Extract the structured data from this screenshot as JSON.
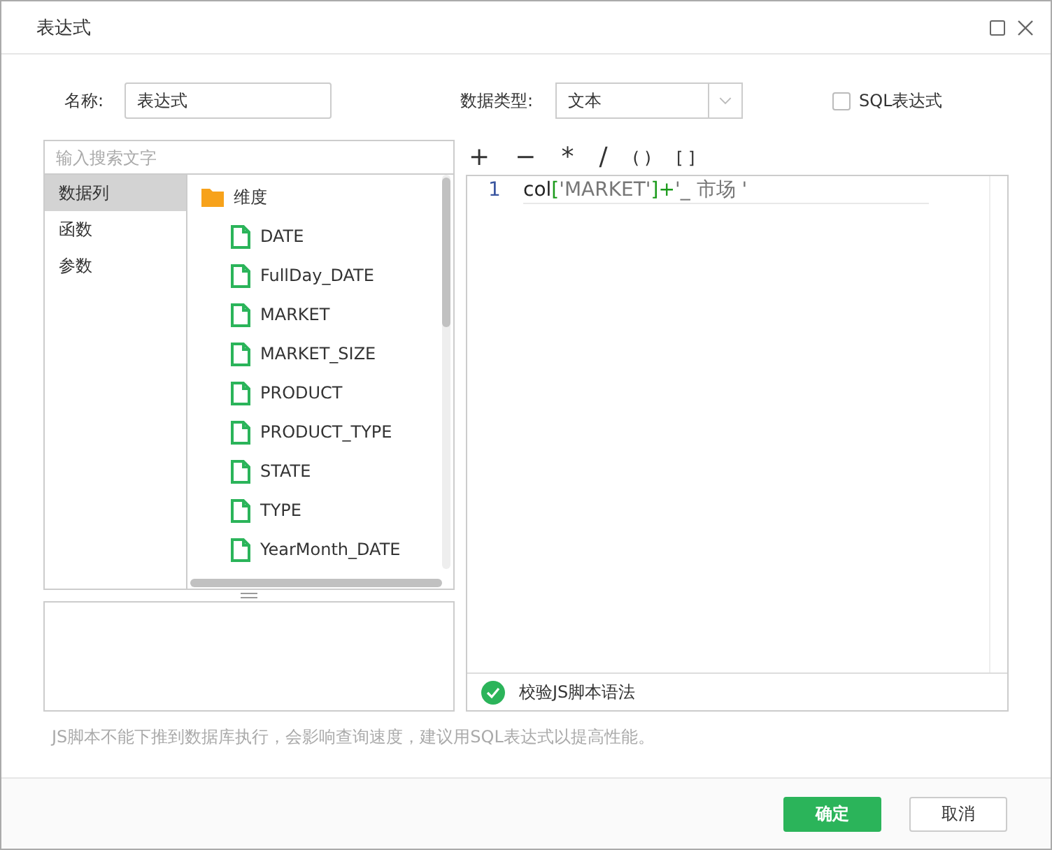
{
  "window": {
    "title": "表达式"
  },
  "name_field": {
    "label": "名称:",
    "value": "表达式"
  },
  "type_field": {
    "label": "数据类型:",
    "value": "文本"
  },
  "sql_option": {
    "label": "SQL表达式",
    "checked": false
  },
  "search": {
    "placeholder": "输入搜索文字"
  },
  "categories": [
    {
      "label": "数据列",
      "selected": true
    },
    {
      "label": "函数",
      "selected": false
    },
    {
      "label": "参数",
      "selected": false
    }
  ],
  "tree": {
    "label": "维度",
    "children": [
      {
        "label": "DATE"
      },
      {
        "label": "FullDay_DATE"
      },
      {
        "label": "MARKET"
      },
      {
        "label": "MARKET_SIZE"
      },
      {
        "label": "PRODUCT"
      },
      {
        "label": "PRODUCT_TYPE"
      },
      {
        "label": "STATE"
      },
      {
        "label": "TYPE"
      },
      {
        "label": "YearMonth_DATE"
      }
    ]
  },
  "operators": [
    "+",
    "−",
    "*",
    "/",
    "( )",
    "[ ]"
  ],
  "editor": {
    "line_number": "1",
    "tokens": [
      {
        "text": "col",
        "kind": "name"
      },
      {
        "text": "[",
        "kind": "bracket"
      },
      {
        "text": "'MARKET'",
        "kind": "string"
      },
      {
        "text": "]+",
        "kind": "bracket"
      },
      {
        "text": "'_ 市场 '",
        "kind": "string"
      }
    ]
  },
  "validate": {
    "label": "校验JS脚本语法"
  },
  "hint": "JS脚本不能下推到数据库执行，会影响查询速度，建议用SQL表达式以提高性能。",
  "buttons": [
    {
      "label": "确定",
      "kind": "primary"
    },
    {
      "label": "取消",
      "kind": "secondary"
    }
  ]
}
